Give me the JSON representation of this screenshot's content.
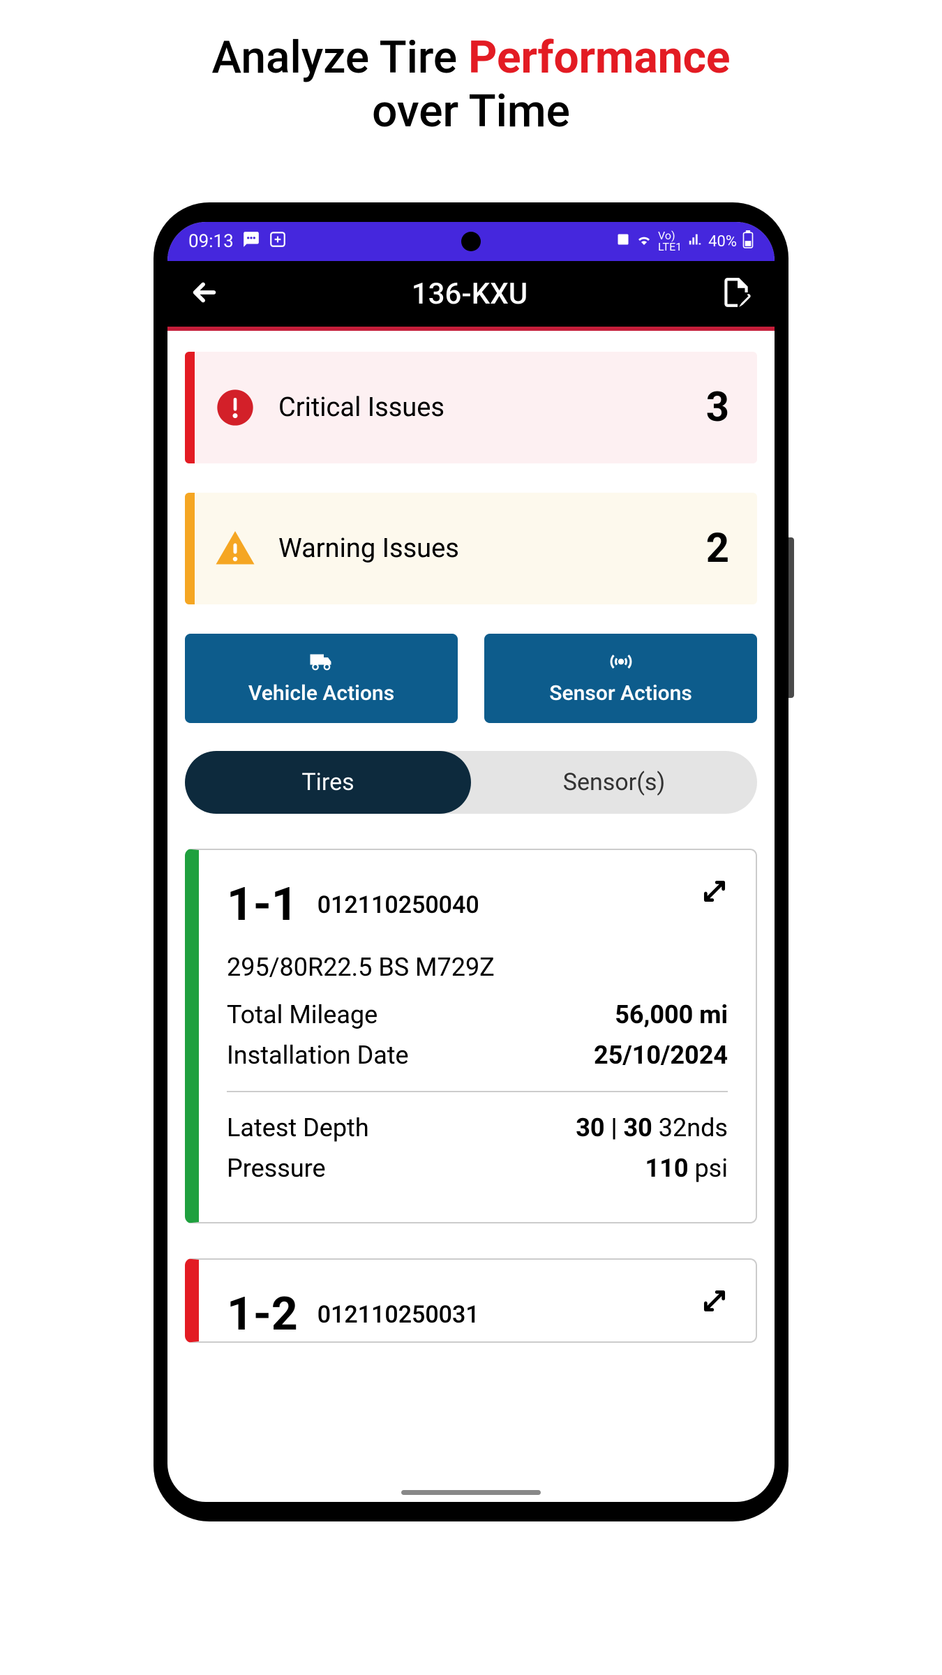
{
  "marketing": {
    "line1a": "Analyze Tire ",
    "line1b": "Performance",
    "line2": "over Time"
  },
  "status_bar": {
    "time": "09:13",
    "battery": "40%",
    "network": "LTE1"
  },
  "header": {
    "title": "136-KXU"
  },
  "issues": {
    "critical_label": "Critical Issues",
    "critical_count": "3",
    "warning_label": "Warning Issues",
    "warning_count": "2"
  },
  "actions": {
    "vehicle": "Vehicle Actions",
    "sensor": "Sensor Actions"
  },
  "tabs": {
    "tires": "Tires",
    "sensors": "Sensor(s)"
  },
  "tires": [
    {
      "position": "1-1",
      "serial": "012110250040",
      "spec": "295/80R22.5 BS M729Z",
      "mileage_label": "Total Mileage",
      "mileage_value": "56,000 mi",
      "install_label": "Installation Date",
      "install_value": "25/10/2024",
      "depth_label": "Latest Depth",
      "depth_value": "30 | 30",
      "depth_unit": " 32nds",
      "pressure_label": "Pressure",
      "pressure_value": "110",
      "pressure_unit": " psi"
    },
    {
      "position": "1-2",
      "serial": "012110250031"
    }
  ]
}
